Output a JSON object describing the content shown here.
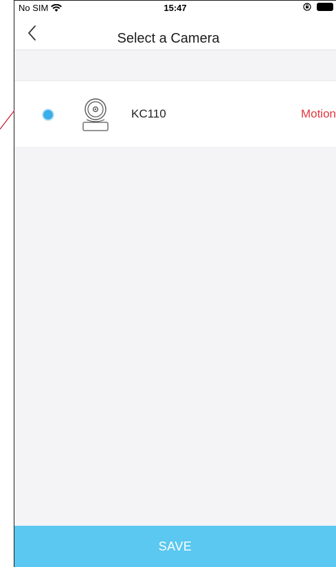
{
  "status_bar": {
    "carrier": "No SIM",
    "time": "15:47",
    "wifi_icon": "wifi-icon",
    "lock_icon": "orientation-lock-icon",
    "battery_icon": "battery-icon"
  },
  "nav": {
    "back_icon": "chevron-left-icon",
    "title": "Select a Camera"
  },
  "cameras": [
    {
      "name": "KC110",
      "status": "Motion",
      "selected": true,
      "icon": "camera-icon"
    }
  ],
  "footer": {
    "save_label": "SAVE"
  },
  "colors": {
    "accent": "#5ac8f0",
    "radio_selected": "#3aaee8",
    "status_alert": "#e0353f",
    "background_gray": "#f4f4f6"
  }
}
